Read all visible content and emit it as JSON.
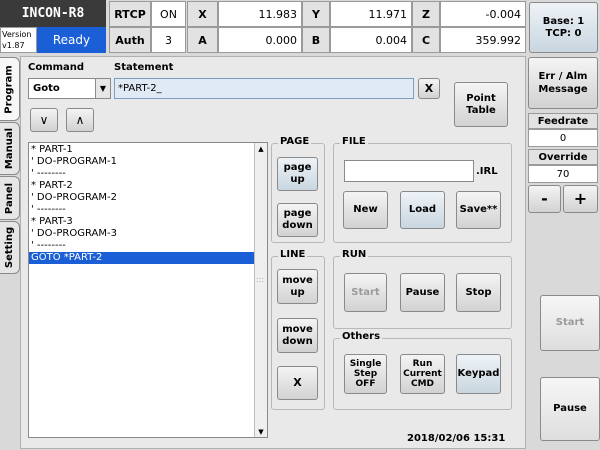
{
  "header": {
    "app_name": "INCON-R8",
    "version_label": "Version",
    "version_value": "v1.87",
    "status": "Ready",
    "rtcp_label": "RTCP",
    "rtcp_value": "ON",
    "auth_label": "Auth",
    "auth_value": "3",
    "coords": {
      "x_label": "X",
      "x_value": "11.983",
      "y_label": "Y",
      "y_value": "11.971",
      "z_label": "Z",
      "z_value": "-0.004",
      "a_label": "A",
      "a_value": "0.000",
      "b_label": "B",
      "b_value": "0.004",
      "c_label": "C",
      "c_value": "359.992"
    },
    "base_tcp_line1": "Base: 1",
    "base_tcp_line2": "TCP: 0"
  },
  "side_tabs": [
    "Program",
    "Manual",
    "Panel",
    "Setting"
  ],
  "editor": {
    "command_label": "Command",
    "statement_label": "Statement",
    "command_value": "Goto",
    "statement_value": "*PART-2_",
    "clear_label": "X",
    "down_label": "∨",
    "up_label": "∧",
    "point_table_label": "Point Table"
  },
  "program_lines": [
    "* PART-1",
    "' DO-PROGRAM-1",
    "' --------",
    "* PART-2",
    "' DO-PROGRAM-2",
    "' --------",
    "* PART-3",
    "' DO-PROGRAM-3",
    "' --------",
    "GOTO *PART-2"
  ],
  "selected_line_index": 9,
  "page": {
    "title": "PAGE",
    "page_up": "page up",
    "page_down": "page down"
  },
  "line": {
    "title": "LINE",
    "move_up": "move up",
    "move_down": "move down",
    "delete": "X"
  },
  "file": {
    "title": "FILE",
    "filename_value": "",
    "extension": ".IRL",
    "new": "New",
    "load": "Load",
    "save": "Save**"
  },
  "run": {
    "title": "RUN",
    "start": "Start",
    "pause": "Pause",
    "stop": "Stop"
  },
  "others": {
    "title": "Others",
    "single_step": "Single Step OFF",
    "run_current": "Run Current CMD",
    "keypad": "Keypad"
  },
  "timestamp": "2018/02/06 15:31",
  "right_panel": {
    "err_alm": "Err / Alm Message",
    "feedrate_label": "Feedrate",
    "feedrate_value": "0",
    "override_label": "Override",
    "override_value": "70",
    "minus": "-",
    "plus": "+",
    "start": "Start",
    "pause": "Pause"
  },
  "colors": {
    "ready_bg": "#1a5fd6",
    "selection_bg": "#1a5fd6",
    "title_bg": "#3a3a3a"
  }
}
